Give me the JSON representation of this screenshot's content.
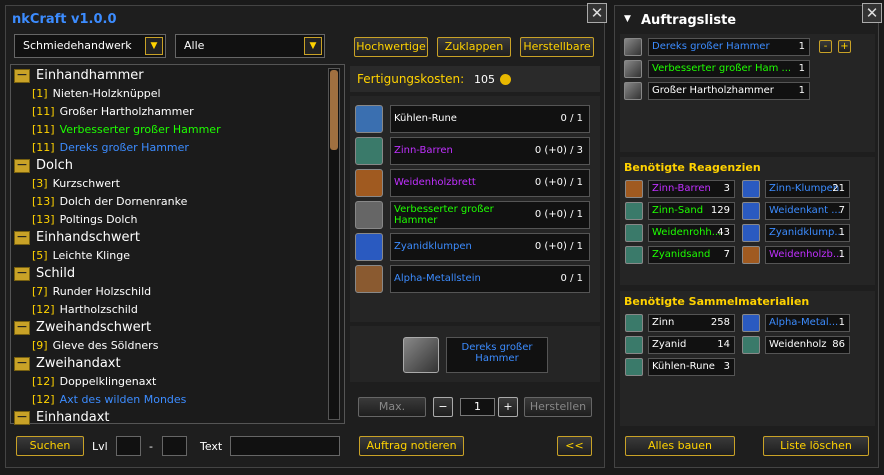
{
  "title": "nkCraft v1.0.0",
  "profession": "Schmiedehandwerk",
  "filter": "Alle",
  "top_buttons": {
    "quality": "Hochwertige",
    "collapse": "Zuklappen",
    "craftable": "Herstellbare"
  },
  "tree": [
    {
      "cat": "Einhandhammer",
      "items": [
        {
          "lv": "[1]",
          "name": "Nieten-Holzknüppel",
          "color": "white"
        },
        {
          "lv": "[11]",
          "name": "Großer Hartholzhammer",
          "color": "white"
        },
        {
          "lv": "[11]",
          "name": "Verbesserter großer Hammer",
          "color": "green"
        },
        {
          "lv": "[11]",
          "name": "Dereks großer Hammer",
          "color": "blue"
        }
      ]
    },
    {
      "cat": "Dolch",
      "items": [
        {
          "lv": "[3]",
          "name": "Kurzschwert",
          "color": "white"
        },
        {
          "lv": "[13]",
          "name": "Dolch der Dornenranke",
          "color": "white"
        },
        {
          "lv": "[13]",
          "name": "Poltings Dolch",
          "color": "white"
        }
      ]
    },
    {
      "cat": "Einhandschwert",
      "items": [
        {
          "lv": "[5]",
          "name": "Leichte Klinge",
          "color": "white"
        }
      ]
    },
    {
      "cat": "Schild",
      "items": [
        {
          "lv": "[7]",
          "name": "Runder Holzschild",
          "color": "white"
        },
        {
          "lv": "[12]",
          "name": "Hartholzschild",
          "color": "white"
        }
      ]
    },
    {
      "cat": "Zweihandschwert",
      "items": [
        {
          "lv": "[9]",
          "name": "Gleve des Söldners",
          "color": "white"
        }
      ]
    },
    {
      "cat": "Zweihandaxt",
      "items": [
        {
          "lv": "[12]",
          "name": "Doppelklingenaxt",
          "color": "white"
        },
        {
          "lv": "[12]",
          "name": "Axt des wilden Mondes",
          "color": "blue"
        }
      ]
    },
    {
      "cat": "Einhandaxt",
      "items": []
    }
  ],
  "cost": {
    "label": "Fertigungskosten:",
    "value": "105"
  },
  "reagents": [
    {
      "name": "Kühlen-Rune",
      "count": "0 / 1",
      "color": "white",
      "icon": "#3a6fb0"
    },
    {
      "name": "Zinn-Barren",
      "count": "0 (+0) / 3",
      "color": "purple",
      "icon": "#3a7a6a"
    },
    {
      "name": "Weidenholzbrett",
      "count": "0 (+0) / 1",
      "color": "purple",
      "icon": "#a05a20"
    },
    {
      "name": "Verbesserter großer Hammer",
      "count": "0 (+0) / 1",
      "color": "green",
      "icon": "#666"
    },
    {
      "name": "Zyanidklumpen",
      "count": "0 (+0) / 1",
      "color": "blue",
      "icon": "#2a5ac0"
    },
    {
      "name": "Alpha-Metallstein",
      "count": "0 / 1",
      "color": "blue",
      "icon": "#8a5a30"
    }
  ],
  "product": {
    "name": "Dereks großer Hammer"
  },
  "craft": {
    "max": "Max.",
    "minus": "−",
    "qty": "1",
    "plus": "+",
    "create": "Herstellen"
  },
  "bottom_left": {
    "search": "Suchen",
    "lvl": "Lvl",
    "dash": "-",
    "text": "Text"
  },
  "order_button": "Auftrag notieren",
  "back_button": "<<",
  "orders": {
    "title": "Auftragsliste",
    "items": [
      {
        "name": "Dereks großer Hammer",
        "count": "1",
        "color": "blue",
        "minus": "-",
        "plus": "+"
      },
      {
        "name": "Verbesserter großer Ham ...",
        "count": "1",
        "color": "green"
      },
      {
        "name": "Großer Hartholzhammer",
        "count": "1",
        "color": "white"
      }
    ]
  },
  "needed_reagents": {
    "title": "Benötigte Reagenzien",
    "items": [
      {
        "name": "Zinn-Barren",
        "count": "3",
        "color": "purple"
      },
      {
        "name": "Zinn-Klumpen",
        "count": "21",
        "color": "blue"
      },
      {
        "name": "Zinn-Sand",
        "count": "129",
        "color": "green"
      },
      {
        "name": "Weidenkant ...",
        "count": "7",
        "color": "blue"
      },
      {
        "name": "Weidenrohh...",
        "count": "43",
        "color": "green"
      },
      {
        "name": "Zyanidklump...",
        "count": "1",
        "color": "blue"
      },
      {
        "name": "Zyanidsand",
        "count": "7",
        "color": "green"
      },
      {
        "name": "Weidenholzb...",
        "count": "1",
        "color": "purple"
      }
    ]
  },
  "gather": {
    "title": "Benötigte Sammelmaterialien",
    "items": [
      {
        "name": "Zinn",
        "count": "258",
        "color": "white"
      },
      {
        "name": "Alpha-Metal...",
        "count": "1",
        "color": "blue"
      },
      {
        "name": "Zyanid",
        "count": "14",
        "color": "white"
      },
      {
        "name": "Weidenholz",
        "count": "86",
        "color": "white"
      },
      {
        "name": "Kühlen-Rune",
        "count": "3",
        "color": "white"
      }
    ]
  },
  "build_all": "Alles bauen",
  "clear_list": "Liste löschen"
}
